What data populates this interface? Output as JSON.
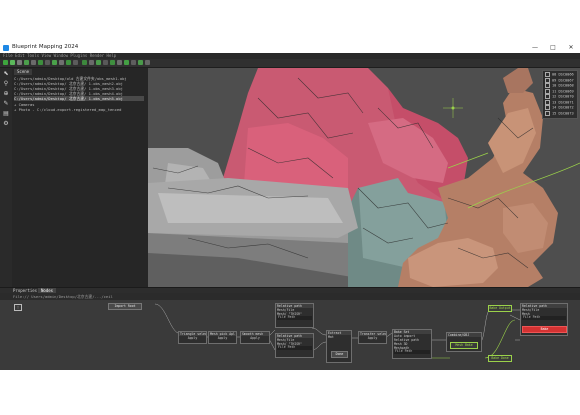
{
  "window": {
    "title": "Blueprint Mapping 2024",
    "minimize": "—",
    "maximize": "□",
    "close": "✕"
  },
  "menubar": {
    "text": "File  Edit  Tools  View  Window  Plugins  Render  Help"
  },
  "scene": {
    "tab": "Scene",
    "rows": [
      "C:/Users/admin/Desktop/old 古建文件夹/obs_mesh1.obj",
      "C:/Users/admin/Desktop/ 北京古建/ 1.obs_mesh2.obj",
      "C:/Users/admin/Desktop/ 北京古建/ 1.obs_mesh3.obj",
      "C:/Users/admin/Desktop/ 北京古建/ 1.obs_mesh4.obj",
      "C:/Users/admin/Desktop/ 北京古建/ 1.obs_mesh5.obj",
      "+ Cameras",
      "+ Photo - C:/cloud.export.registered_map_tenced"
    ],
    "selected_index": 4
  },
  "projections": [
    {
      "id": "08",
      "name": "DSC0066"
    },
    {
      "id": "09",
      "name": "DSC0067"
    },
    {
      "id": "10",
      "name": "DSC0068"
    },
    {
      "id": "11",
      "name": "DSC0069"
    },
    {
      "id": "12",
      "name": "DSC0070"
    },
    {
      "id": "13",
      "name": "DSC0071"
    },
    {
      "id": "14",
      "name": "DSC0072"
    },
    {
      "id": "15",
      "name": "DSC0073"
    }
  ],
  "bottom_tabs": {
    "properties": "Properties",
    "nodegraph": "Nodes"
  },
  "path": "File:// Users/admin/Desktop/北京古建/.../ceil",
  "nodes": {
    "import_root": "Import Root",
    "triangle_select": "Triangle select",
    "triangle_apply": "Apply",
    "mesh_select": "Mesh pick Apl",
    "mesh_apply": "Apply",
    "smooth_select": "Smooth mesh",
    "smooth_apply": "Apply",
    "relative_path_1": "Relative path",
    "mesh_file_1": "Mesh/File",
    "mesh_label_1": "Mesh/ \"THISR\"",
    "file_path_1": "File Path",
    "relative_path_2": "Relative path",
    "mesh_file_2": "Mesh/File",
    "mesh_label_2": "Mesh/ \"THISR\"",
    "file_path_2": "File Path",
    "bake_set_1": "Bake Set",
    "auto_import_1": "Auto import",
    "mesh_3d_1": "Mesh 3D",
    "file_path_3": "File Path",
    "extract_main": "Extract",
    "extract_mat": "Mat",
    "extract_btn": "Done",
    "transform_select": "Transfer select",
    "transform_apply": "Apply",
    "bake_set_2": "Bake Set",
    "auto_import_2": "Auto import",
    "relative_path_3": "Relative path",
    "mesh_3d_2": "Mesh 3D",
    "meshpath": "Meshpath",
    "file_path_4": "File Path",
    "combine": "Combine/OBJ",
    "combine_btn": "Mesh Bake",
    "relative_path_4": "Relative path",
    "mesh_file_4": "Mesh/File",
    "mesh_4": "Mesh",
    "file_path_5": "File Path",
    "out_label": "Bake Output",
    "out_label_2": "Bake Done",
    "red_btn": "Bake",
    "export_label": "Export"
  },
  "colors": {
    "accent_green": "#9bd24a",
    "red": "#d43232",
    "link_gray": "#aaaaaa"
  }
}
